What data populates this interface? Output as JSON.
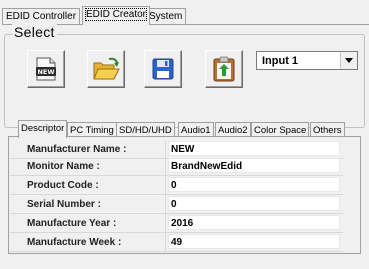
{
  "main_tabs": [
    {
      "label": "EDID Controller",
      "active": false
    },
    {
      "label": "EDID Creator",
      "active": true
    },
    {
      "label": "System",
      "active": false
    }
  ],
  "select_group": {
    "title": "Select",
    "icons": [
      "new-document-icon",
      "open-folder-icon",
      "save-icon",
      "upload-clipboard-icon"
    ],
    "input_select": {
      "value": "Input 1"
    }
  },
  "sub_tabs": [
    {
      "label": "Descriptor",
      "active": true
    },
    {
      "label": "PC Timing",
      "active": false
    },
    {
      "label": "SD/HD/UHD",
      "active": false
    },
    {
      "label": "Audio1",
      "active": false
    },
    {
      "label": "Audio2",
      "active": false
    },
    {
      "label": "Color Space",
      "active": false
    },
    {
      "label": "Others",
      "active": false
    }
  ],
  "descriptor": {
    "rows": [
      {
        "label": "Manufacturer Name :",
        "value": "NEW"
      },
      {
        "label": "Monitor Name :",
        "value": "BrandNewEdid"
      },
      {
        "label": "Product Code :",
        "value": "0"
      },
      {
        "label": "Serial Number :",
        "value": "0"
      },
      {
        "label": "Manufacture Year :",
        "value": "2016"
      },
      {
        "label": "Manufacture Week :",
        "value": "49"
      }
    ]
  },
  "colors": {
    "window_bg": "#f0f0f0",
    "field_bg": "#ffffff",
    "border": "#a0a0a0"
  }
}
